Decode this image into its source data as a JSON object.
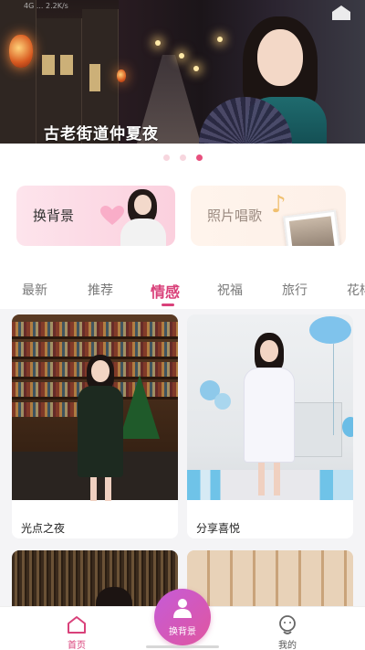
{
  "status_bar": {
    "text": "4G ... 2.2K/s"
  },
  "banner": {
    "title": "古老街道仲夏夜",
    "dots": [
      {
        "active": false
      },
      {
        "active": false
      },
      {
        "active": true
      }
    ]
  },
  "features": [
    {
      "label": "换背景"
    },
    {
      "label": "照片唱歌"
    }
  ],
  "tabs": [
    {
      "label": "最新",
      "active": false
    },
    {
      "label": "推荐",
      "active": false
    },
    {
      "label": "情感",
      "active": true
    },
    {
      "label": "祝福",
      "active": false
    },
    {
      "label": "旅行",
      "active": false
    },
    {
      "label": "花样",
      "active": false
    }
  ],
  "cards": [
    {
      "caption": "光点之夜"
    },
    {
      "caption": "分享喜悦"
    },
    {
      "caption": ""
    },
    {
      "caption": ""
    }
  ],
  "bottom_nav": {
    "home": {
      "label": "首页",
      "icon": "home-icon"
    },
    "center": {
      "label": "换背景",
      "icon": "user-icon"
    },
    "mine": {
      "label": "我的",
      "icon": "profile-icon"
    }
  },
  "colors": {
    "accent": "#d9417a",
    "fab_start": "#c55bd8",
    "fab_end": "#e056a0",
    "dot_active": "#e8507e"
  }
}
